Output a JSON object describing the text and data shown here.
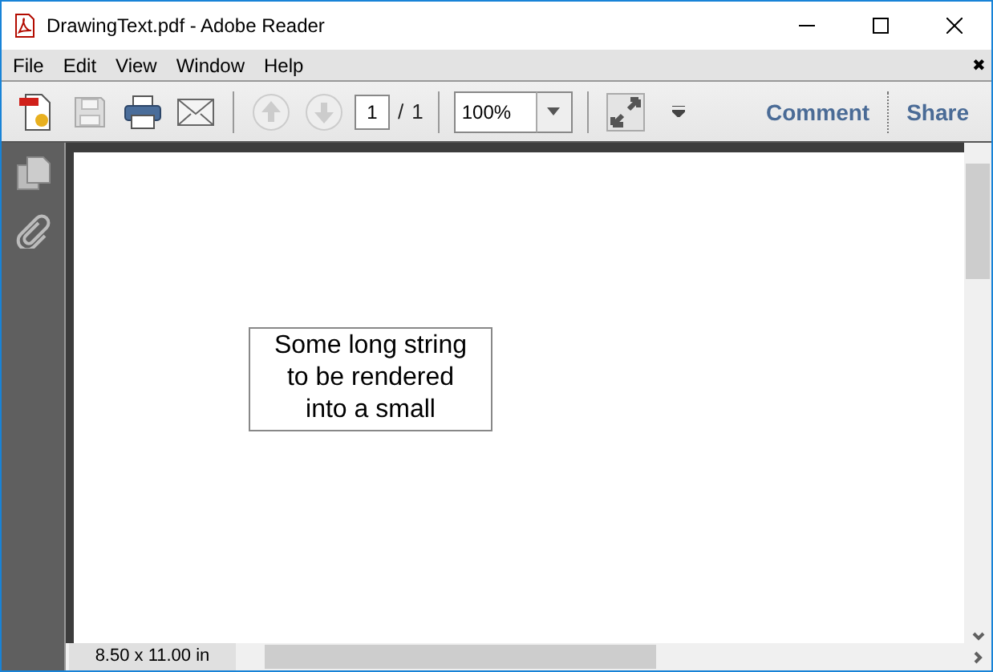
{
  "window": {
    "title": "DrawingText.pdf - Adobe Reader"
  },
  "menu": [
    "File",
    "Edit",
    "View",
    "Window",
    "Help"
  ],
  "menu_close": "✖",
  "toolbar": {
    "page_current": "1",
    "page_separator": "/",
    "page_total": "1",
    "zoom": "100%",
    "comment": "Comment",
    "share": "Share"
  },
  "document": {
    "text_box": "Some long string to be rendered into a small"
  },
  "status": {
    "page_size": "8.50 x 11.00 in"
  }
}
